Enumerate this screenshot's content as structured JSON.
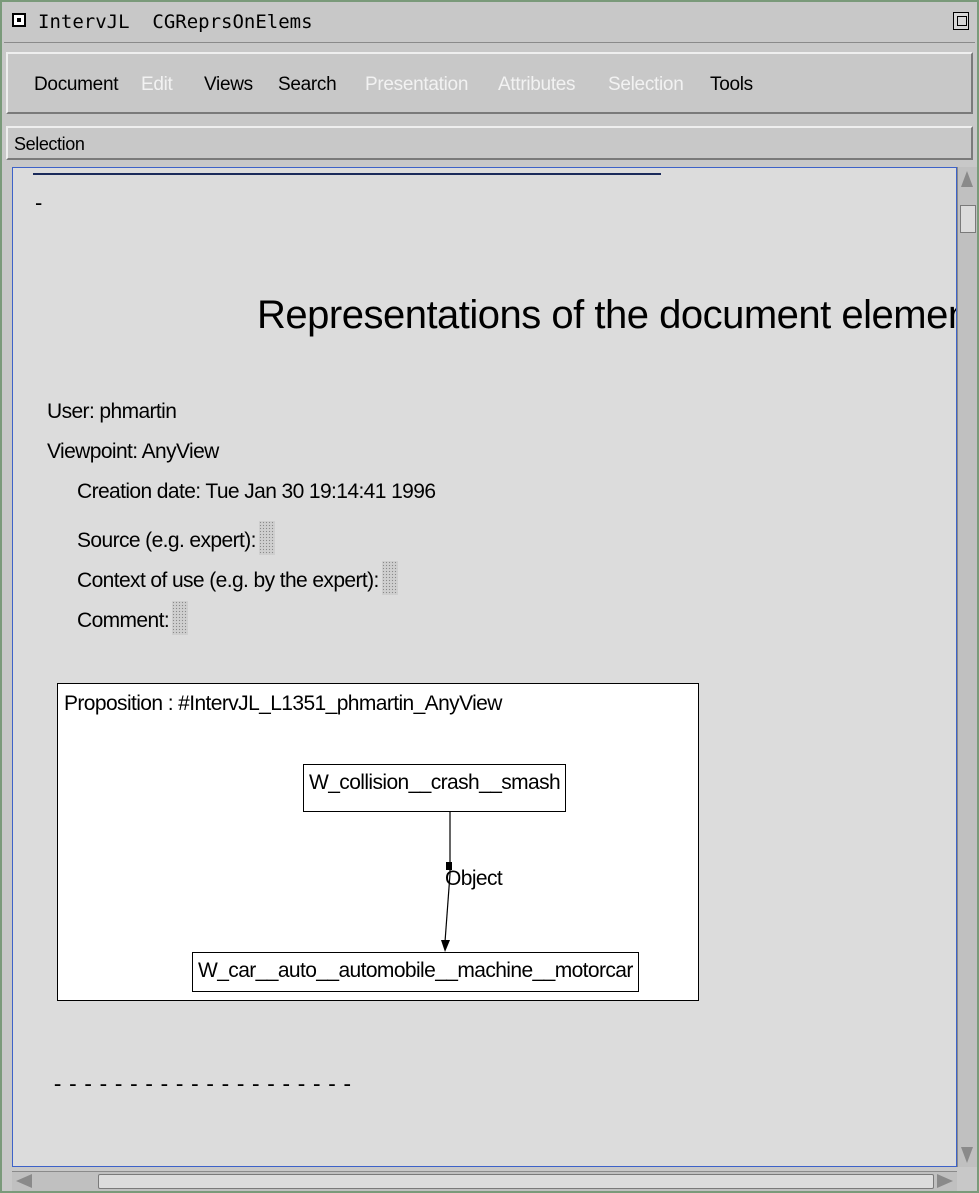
{
  "window": {
    "title": "IntervJL  CGReprsOnElems",
    "icons": [
      "window-menu-icon",
      "maximize-icon"
    ]
  },
  "menubar": {
    "items": [
      {
        "label": "Document",
        "enabled": true
      },
      {
        "label": "Edit",
        "enabled": false
      },
      {
        "label": "Views",
        "enabled": true
      },
      {
        "label": "Search",
        "enabled": true
      },
      {
        "label": "Presentation",
        "enabled": false
      },
      {
        "label": "Attributes",
        "enabled": false
      },
      {
        "label": "Selection",
        "enabled": false
      },
      {
        "label": "Tools",
        "enabled": true
      }
    ]
  },
  "modebar": {
    "label": "Selection"
  },
  "document": {
    "leading_dash": "-",
    "title": "Representations of the document element",
    "user": "User: phmartin",
    "viewpoint": "Viewpoint: AnyView",
    "creation_date": "Creation date: Tue Jan 30 19:14:41 1996",
    "source_label": "Source (e.g. expert):",
    "context_label": "Context of use (e.g. by the expert):",
    "comment_label": "Comment:",
    "proposition": {
      "label": "Proposition : #IntervJL_L1351_phmartin_AnyView",
      "concept_top": "W_collision__crash__smash",
      "relation": "Object",
      "concept_bottom": "W_car__auto__automobile__machine__motorcar"
    },
    "trailing_dashes": "--------------------"
  },
  "colors": {
    "window_bg": "#c8c8c8",
    "document_bg": "#dcdcdc",
    "disabled_menu_text": "#f2f2f2",
    "document_border": "#3d62c8"
  }
}
